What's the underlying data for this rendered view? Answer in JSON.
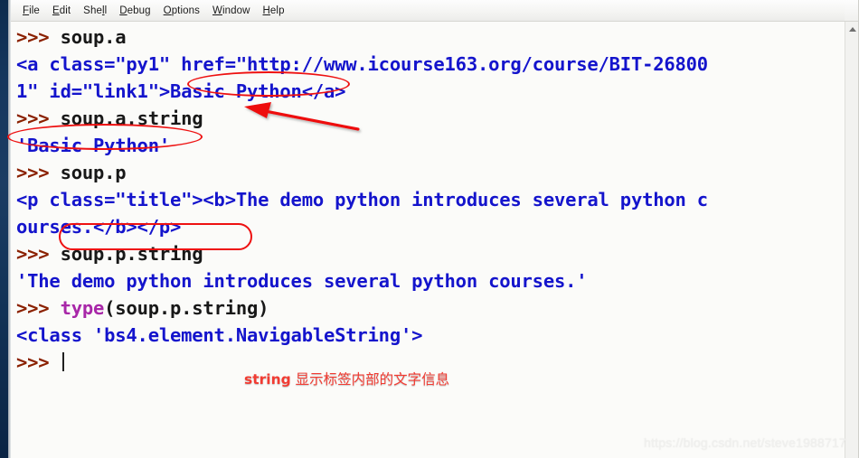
{
  "window": {
    "app": "Python IDLE Shell"
  },
  "menubar": {
    "items": [
      {
        "name": "file",
        "mnemonic": "F",
        "rest": "ile"
      },
      {
        "name": "edit",
        "mnemonic": "E",
        "rest": "dit"
      },
      {
        "name": "shell",
        "mnemonic": "S",
        "rest": "hel",
        "tail": "l",
        "mnemonic_pos": "mid"
      },
      {
        "name": "debug",
        "mnemonic": "D",
        "rest": "ebug"
      },
      {
        "name": "options",
        "mnemonic": "O",
        "rest": "ptions"
      },
      {
        "name": "window",
        "mnemonic": "W",
        "rest": "indow"
      },
      {
        "name": "help",
        "mnemonic": "H",
        "rest": "elp"
      }
    ],
    "labels": {
      "file": "File",
      "edit": "Edit",
      "shell": "Shell",
      "debug": "Debug",
      "options": "Options",
      "window": "Window",
      "help": "Help"
    }
  },
  "shell": {
    "prompt": ">>> ",
    "lines": [
      {
        "kind": "input",
        "prompt": ">>> ",
        "text": "soup.a"
      },
      {
        "kind": "output",
        "text": "<a class=\"py1\" href=\"http://www.icourse163.org/course/BIT-26800"
      },
      {
        "kind": "output",
        "text": "1\" id=\"link1\">Basic Python</a>"
      },
      {
        "kind": "input",
        "prompt": ">>> ",
        "text": "soup.a.string"
      },
      {
        "kind": "output",
        "text": "'Basic Python'"
      },
      {
        "kind": "input",
        "prompt": ">>> ",
        "text": "soup.p"
      },
      {
        "kind": "output",
        "text": "<p class=\"title\"><b>The demo python introduces several python c"
      },
      {
        "kind": "output",
        "text": "ourses.</b></p>"
      },
      {
        "kind": "input",
        "prompt": ">>> ",
        "text": "soup.p.string"
      },
      {
        "kind": "output",
        "text": "'The demo python introduces several python courses.'"
      },
      {
        "kind": "input",
        "prompt": ">>> ",
        "builtin": "type",
        "text": "(soup.p.string)"
      },
      {
        "kind": "output",
        "text": "<class 'bs4.element.NavigableString'>"
      },
      {
        "kind": "input",
        "prompt": ">>> ",
        "text": "",
        "caret": true
      }
    ]
  },
  "annotations": {
    "caption_keyword": "string",
    "caption_text": " 显示标签内部的文字信息",
    "highlight_1": "Basic Python",
    "highlight_2": "'Basic Python'",
    "highlight_3": "soup.p.string",
    "arrow_target": "soup.a.string",
    "color": "#ee1111"
  },
  "watermark": {
    "text": "https://blog.csdn.net/steve1988717"
  },
  "colors": {
    "prompt": "#8b2100",
    "input": "#181818",
    "output": "#1414cc",
    "builtin": "#a827a8",
    "annotation_red": "#ee1111",
    "caption_red": "#f23b32",
    "shell_bg": "#fbfbf9",
    "desktop": "#16375e"
  }
}
